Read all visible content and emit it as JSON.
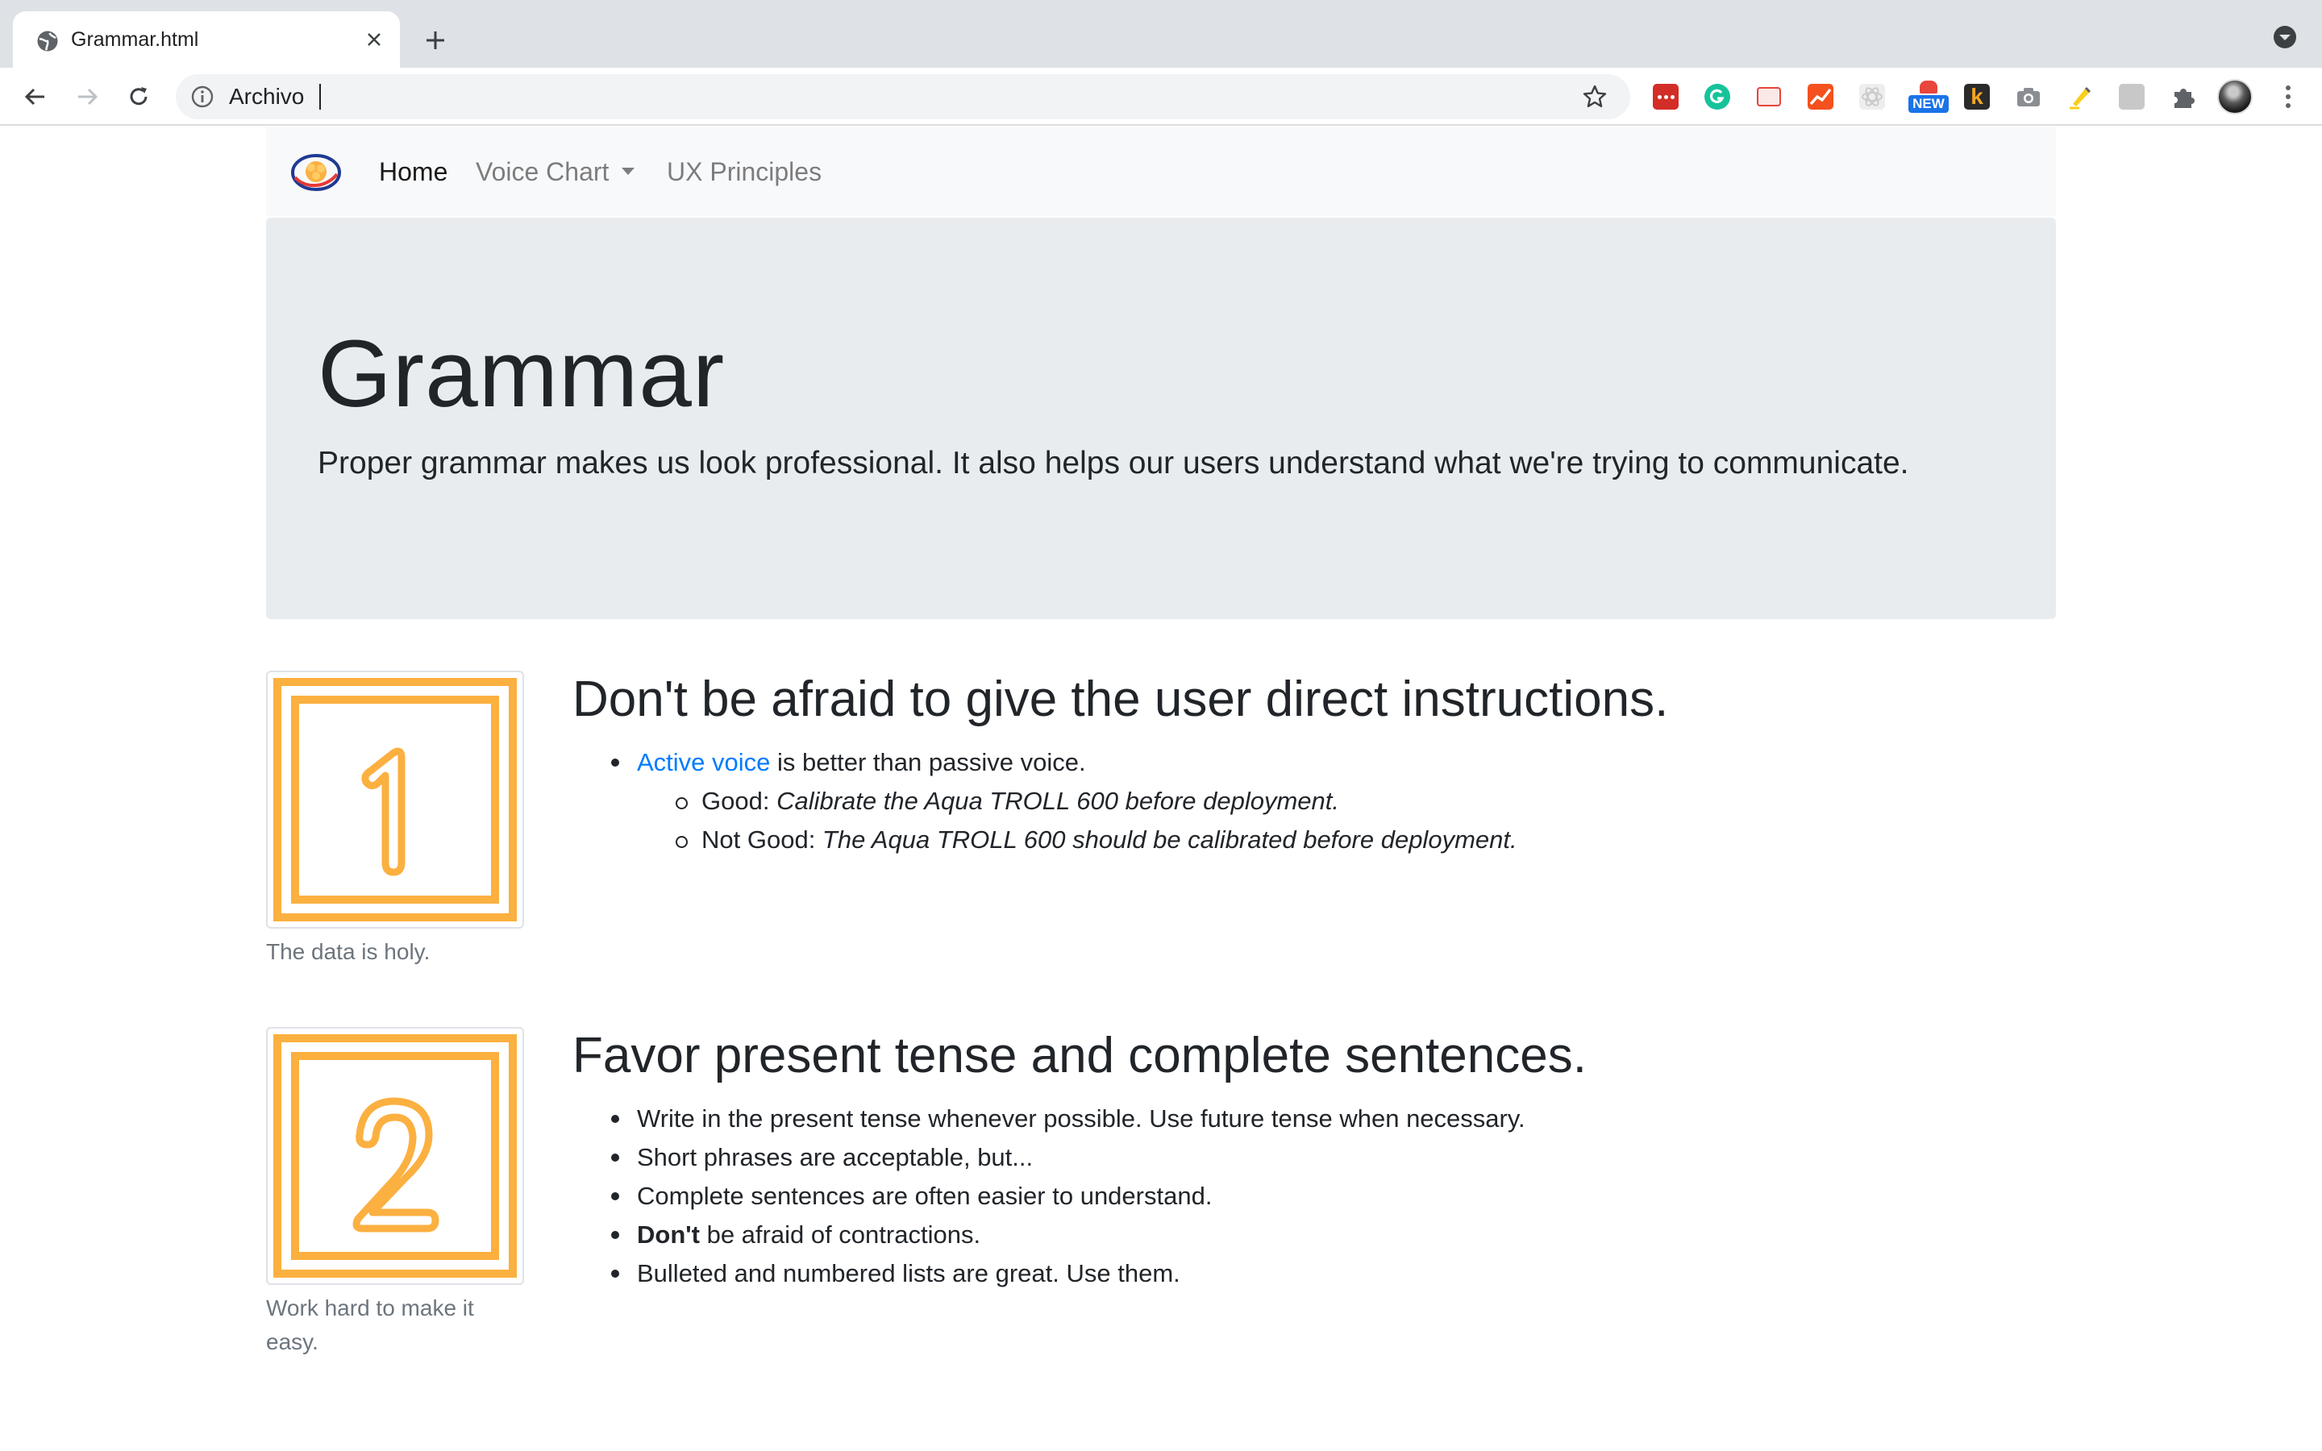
{
  "browser": {
    "tab_title": "Grammar.html",
    "address_text": "Archivo",
    "extensions": [
      {
        "name": "lastpass-icon",
        "color": "#d32d27"
      },
      {
        "name": "grammarly-icon",
        "color": "#15c39a"
      },
      {
        "name": "pdf-icon",
        "color": "#e8453c"
      },
      {
        "name": "analytics-icon",
        "color": "#f4511e"
      },
      {
        "name": "react-devtools-icon",
        "color": "#c8c8c8"
      },
      {
        "name": "new-badge-icon",
        "color": "#1a73e8",
        "label": "NEW"
      },
      {
        "name": "k-extension-icon",
        "color": "#2b2b2b",
        "label": "k"
      },
      {
        "name": "camera-icon",
        "color": "#5f6368"
      },
      {
        "name": "highlighter-icon",
        "color": "#f9ce1d"
      },
      {
        "name": "translate-icon",
        "color": "#9aa0a6"
      },
      {
        "name": "extensions-puzzle-icon",
        "color": "#5f6368"
      }
    ]
  },
  "navbar": {
    "items": [
      {
        "label": "Home"
      },
      {
        "label": "Voice Chart"
      },
      {
        "label": "UX Principles"
      }
    ]
  },
  "jumbotron": {
    "title": "Grammar",
    "lead": "Proper grammar makes us look professional. It also helps our users understand what we're trying to communicate."
  },
  "sections": [
    {
      "number": "1",
      "caption": "The data is holy.",
      "heading": "Don't be afraid to give the user direct instructions.",
      "bullet_link": "Active voice",
      "bullet_rest": " is better than passive voice.",
      "good_label": "Good: ",
      "good_example": "Calibrate the Aqua TROLL 600 before deployment.",
      "bad_label": "Not Good: ",
      "bad_example": "The Aqua TROLL 600 should be calibrated before deployment."
    },
    {
      "number": "2",
      "caption": "Work hard to make it easy.",
      "heading": "Favor present tense and complete sentences.",
      "bullets": [
        "Write in the present tense whenever possible. Use future tense when necessary.",
        "Short phrases are acceptable, but...",
        "Complete sentences are often easier to understand."
      ],
      "bold_word": "Don't",
      "bold_rest": " be afraid of contractions.",
      "last_bullet": "Bulleted and numbered lists are great. Use them."
    }
  ],
  "colors": {
    "accent_orange": "#fbb040",
    "link_blue": "#007bff",
    "jumbotron_bg": "#e9ecef",
    "navbar_bg": "#f8f9fa"
  }
}
